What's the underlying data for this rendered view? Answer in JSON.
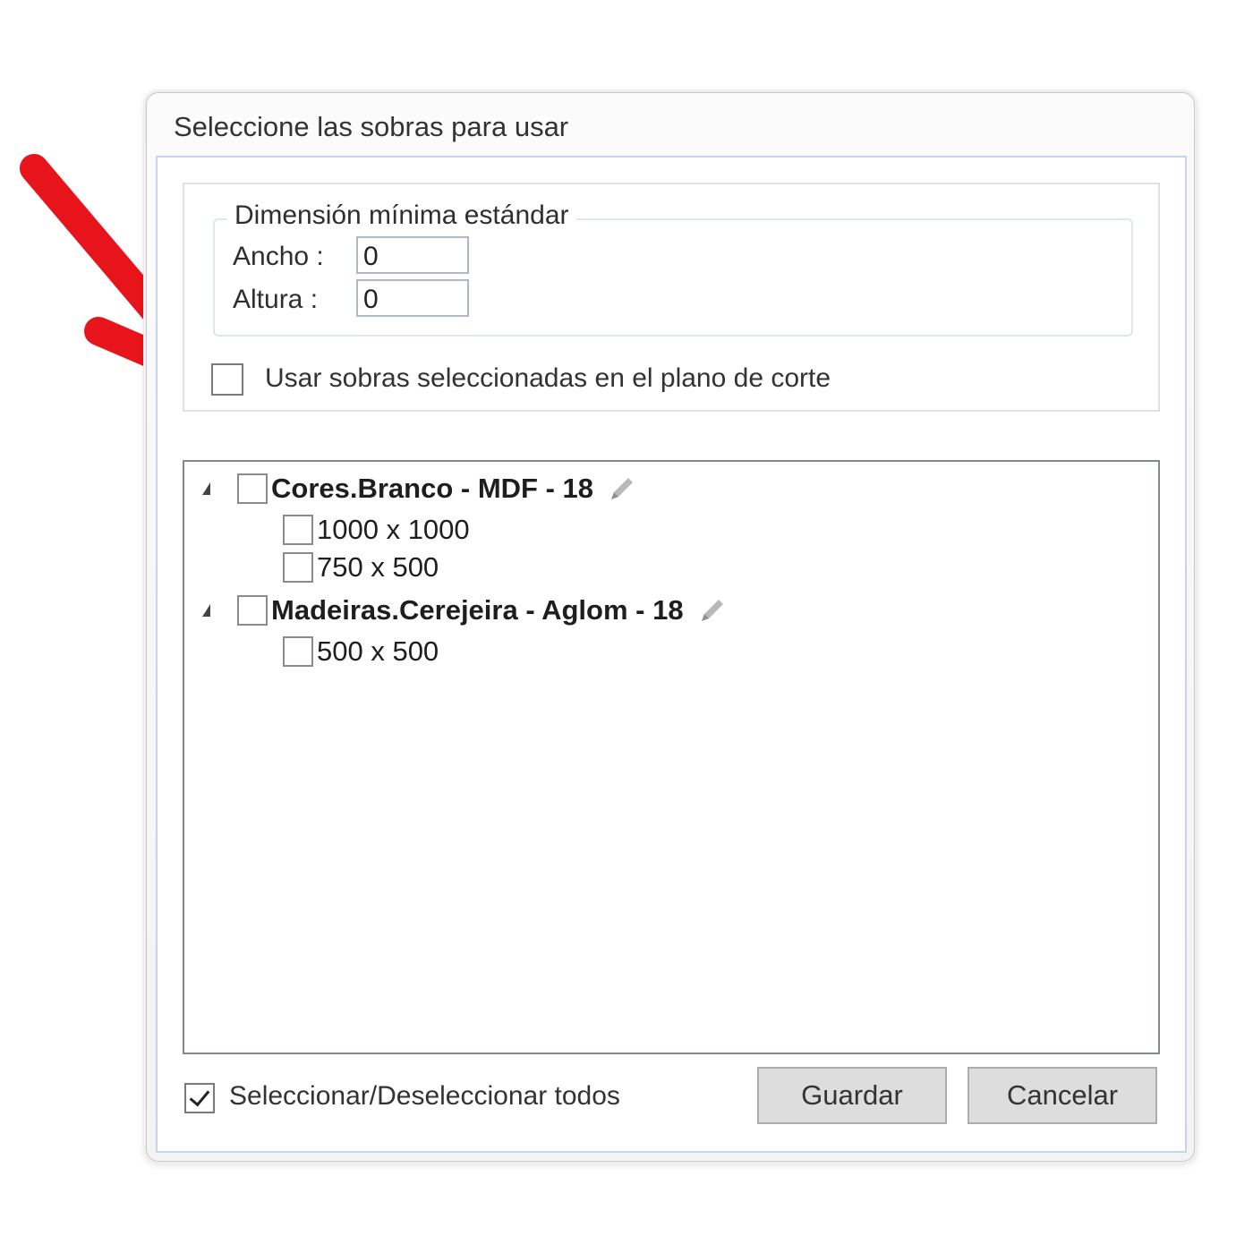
{
  "dialog": {
    "title": "Seleccione las sobras para usar",
    "dimension_group": {
      "legend": "Dimensión mínima estándar",
      "width_label": "Ancho :",
      "width_value": "0",
      "height_label": "Altura :",
      "height_value": "0"
    },
    "use_selected_checkbox": {
      "label": "Usar sobras seleccionadas en el plano de corte",
      "checked": false
    },
    "tree": [
      {
        "label": "Cores.Branco - MDF - 18",
        "children": [
          "1000 x 1000",
          "750 x 500"
        ]
      },
      {
        "label": "Madeiras.Cerejeira - Aglom - 18",
        "children": [
          "500 x 500"
        ]
      }
    ],
    "select_all": {
      "label": "Seleccionar/Deseleccionar todos",
      "checked": true
    },
    "buttons": {
      "save": "Guardar",
      "cancel": "Cancelar"
    }
  },
  "annotation": {
    "arrow_color": "#e8141b"
  },
  "icons": {
    "edit": "pencil-icon",
    "expand": "triangle-expanded-icon"
  }
}
